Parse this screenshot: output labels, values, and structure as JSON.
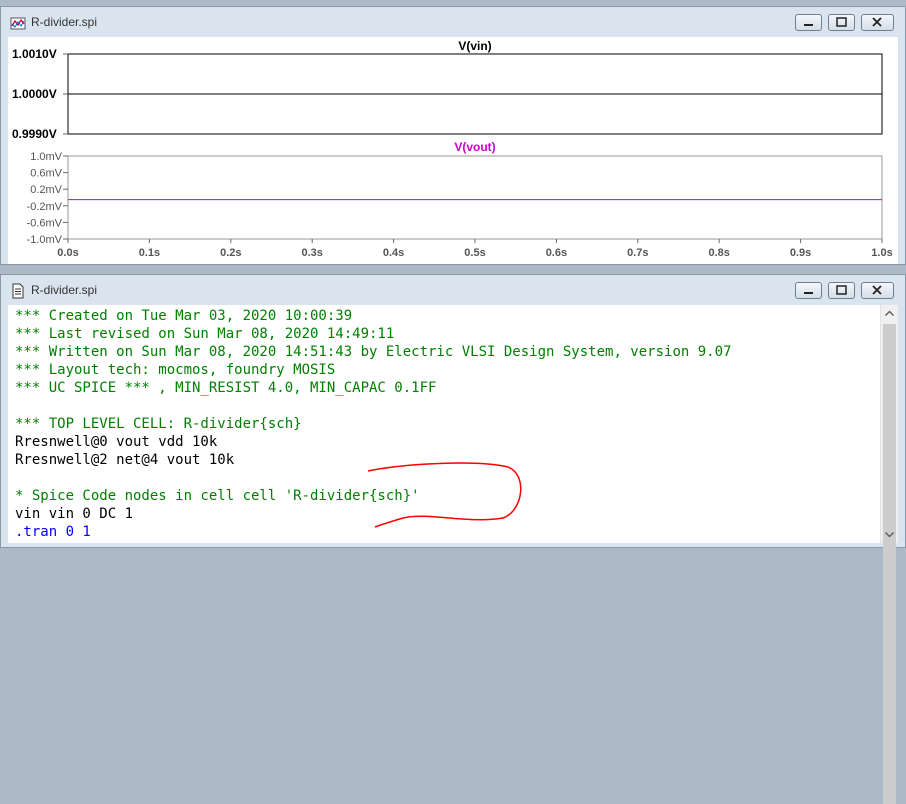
{
  "waveform_window": {
    "title": "R-divider.spi",
    "icon": "waveform-file-icon"
  },
  "netlist_window": {
    "title": "R-divider.spi",
    "icon": "document-icon"
  },
  "colors": {
    "comment": "#008000",
    "code": "#000000",
    "directive": "#0000ff",
    "vout_trace": "#cc00cc",
    "vin_trace": "#000000",
    "annotation": "#ff0000"
  },
  "chart_data": [
    {
      "type": "line",
      "title": "V(vin)",
      "yticks": [
        "1.0010V",
        "1.0000V",
        "0.9990V"
      ],
      "ylim": [
        0.999,
        1.001
      ],
      "series": [
        {
          "name": "V(vin)",
          "x": [
            0,
            1.0
          ],
          "y": [
            1.0,
            1.0
          ]
        }
      ],
      "grid": false
    },
    {
      "type": "line",
      "title": "V(vout)",
      "yticks": [
        "1.0mV",
        "0.6mV",
        "0.2mV",
        "-0.2mV",
        "-0.6mV",
        "-1.0mV"
      ],
      "ylim": [
        -1.0,
        1.0
      ],
      "xticks": [
        "0.0s",
        "0.1s",
        "0.2s",
        "0.3s",
        "0.4s",
        "0.5s",
        "0.6s",
        "0.7s",
        "0.8s",
        "0.9s",
        "1.0s"
      ],
      "xlim": [
        0,
        1.0
      ],
      "series": [
        {
          "name": "V(vout)",
          "x": [
            0,
            1.0
          ],
          "y": [
            -0.05,
            -0.05
          ]
        }
      ],
      "grid": false
    }
  ],
  "netlist": {
    "lines": [
      {
        "text": "*** Created on Tue Mar 03, 2020 10:00:39",
        "kind": "comment"
      },
      {
        "text": "*** Last revised on Sun Mar 08, 2020 14:49:11",
        "kind": "comment"
      },
      {
        "text": "*** Written on Sun Mar 08, 2020 14:51:43 by Electric VLSI Design System, version 9.07",
        "kind": "comment"
      },
      {
        "text": "*** Layout tech: mocmos, foundry MOSIS",
        "kind": "comment"
      },
      {
        "text": "*** UC SPICE *** , MIN_RESIST 4.0, MIN_CAPAC 0.1FF",
        "kind": "comment"
      },
      {
        "text": "",
        "kind": "blank"
      },
      {
        "text": "*** TOP LEVEL CELL: R-divider{sch}",
        "kind": "comment"
      },
      {
        "text": "Rresnwell@0 vout vdd 10k",
        "kind": "code"
      },
      {
        "text": "Rresnwell@2 net@4 vout 10k",
        "kind": "code"
      },
      {
        "text": "",
        "kind": "blank"
      },
      {
        "text": "* Spice Code nodes in cell cell 'R-divider{sch}'",
        "kind": "comment"
      },
      {
        "text": "vin vin 0 DC 1",
        "kind": "code"
      },
      {
        "text": ".tran 0 1",
        "kind": "directive"
      }
    ]
  }
}
